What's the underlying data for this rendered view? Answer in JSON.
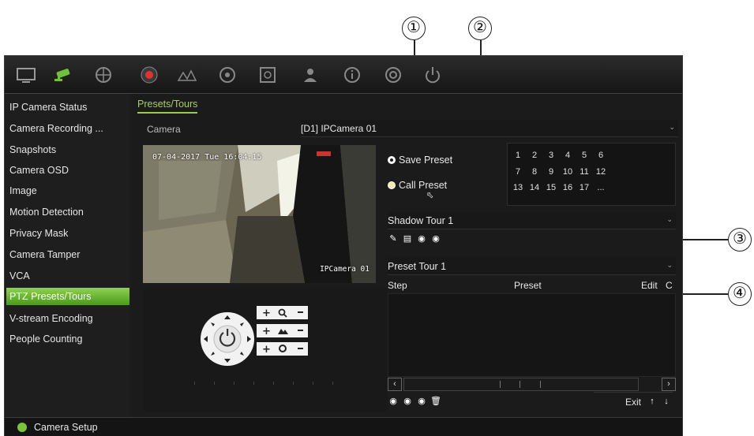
{
  "callouts": [
    "①",
    "②",
    "③",
    "④"
  ],
  "sidebar": {
    "items": [
      {
        "label": "IP Camera Status"
      },
      {
        "label": "Camera Recording ..."
      },
      {
        "label": "Snapshots"
      },
      {
        "label": "Camera OSD"
      },
      {
        "label": "Image"
      },
      {
        "label": "Motion Detection"
      },
      {
        "label": "Privacy Mask"
      },
      {
        "label": "Camera Tamper"
      },
      {
        "label": "VCA"
      },
      {
        "label": "PTZ Presets/Tours"
      },
      {
        "label": "V-stream Encoding"
      },
      {
        "label": "People Counting"
      }
    ],
    "active_index": 9
  },
  "tab": "Presets/Tours",
  "camera": {
    "label": "Camera",
    "value": "[D1] IPCamera 01"
  },
  "video": {
    "timestamp": "07-04-2017 Tue 16:04:15",
    "camera_name": "IPCamera 01"
  },
  "presets": {
    "save_label": "Save Preset",
    "call_label": "Call Preset",
    "numbers": [
      "1",
      "2",
      "3",
      "4",
      "5",
      "6",
      "7",
      "8",
      "9",
      "10",
      "11",
      "12",
      "13",
      "14",
      "15",
      "16",
      "17",
      "..."
    ]
  },
  "shadow_tour": {
    "value": "Shadow Tour 1"
  },
  "preset_tour": {
    "value": "Preset Tour 1",
    "columns": [
      "Step",
      "Preset",
      "Edit",
      "C"
    ]
  },
  "exit_label": "Exit",
  "status": {
    "label": "Camera Setup",
    "accent": "#7cc23a"
  },
  "colors": {
    "accent": "#8fd14f",
    "background": "#1b1b1b"
  }
}
